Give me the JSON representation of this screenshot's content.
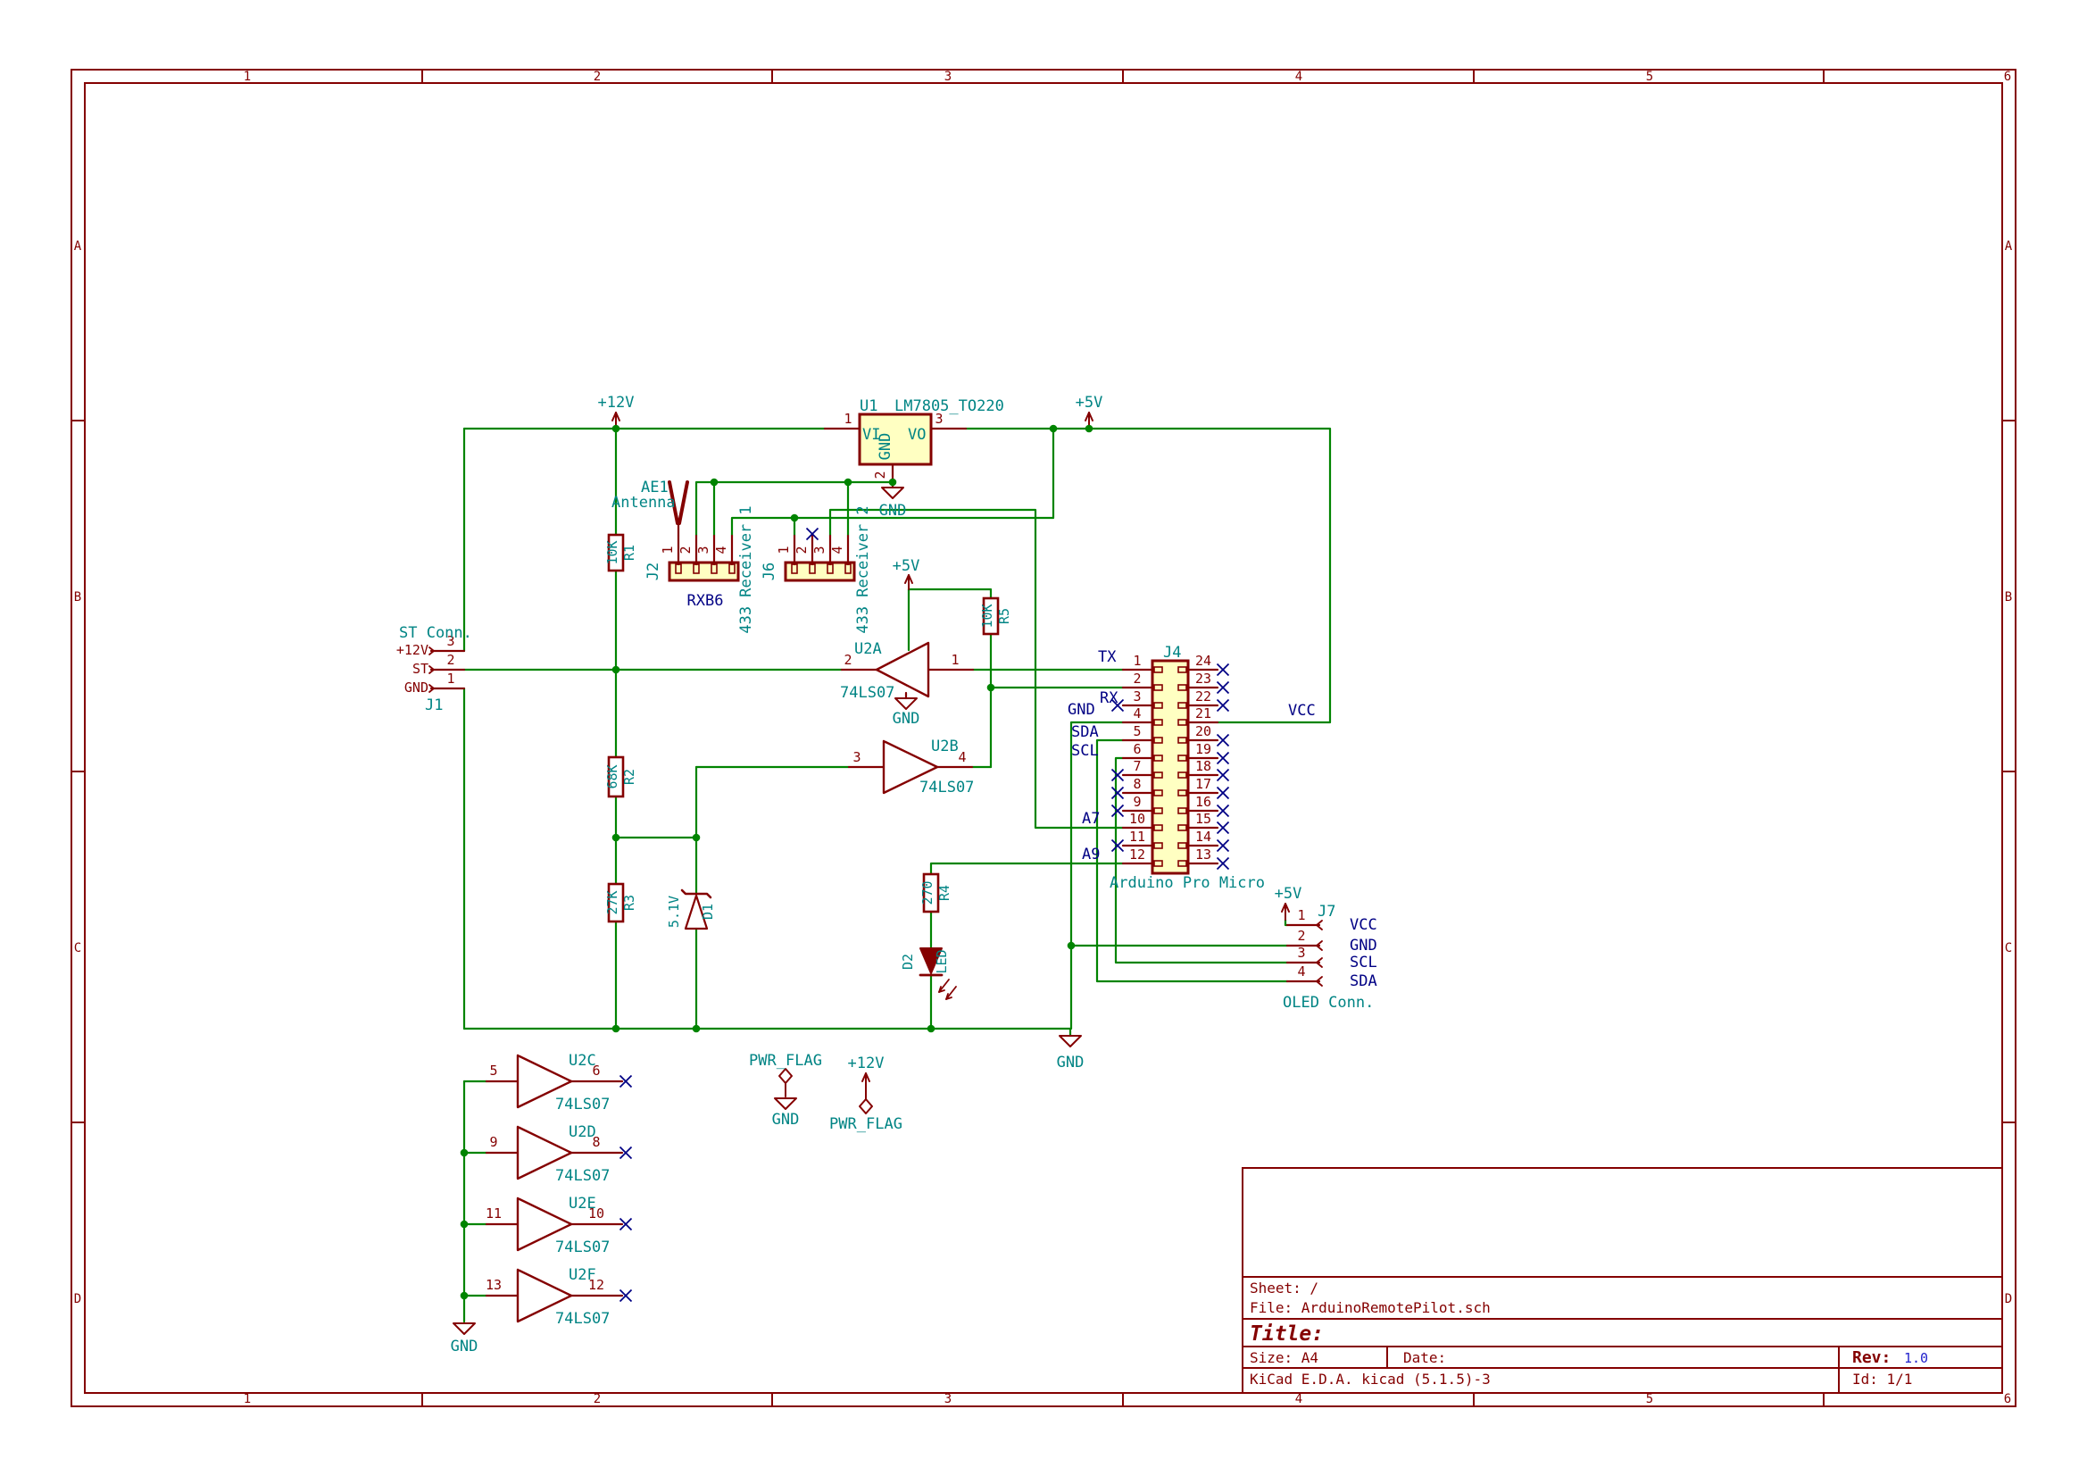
{
  "colors": {
    "wire": "#008400",
    "symbol": "#840000",
    "field": "#008484",
    "label": "#000084",
    "body_fill": "#FFFFC2",
    "paper": "#FFFFFF"
  },
  "schematic": {
    "power_labels": {
      "p12v": "+12V",
      "p5v": "+5V",
      "gnd": "GND",
      "pwr_flag": "PWR_FLAG"
    },
    "net_labels": {
      "tx": "TX",
      "rx": "RX",
      "gnd": "GND",
      "sda": "SDA",
      "scl": "SCL",
      "a7": "A7",
      "a9": "A9",
      "vcc": "VCC"
    },
    "components": {
      "u1": {
        "ref": "U1",
        "value": "LM7805_TO220",
        "pin_nums": [
          "1",
          "2",
          "3"
        ],
        "pin_names": {
          "vi": "VI",
          "vo": "VO",
          "gnd": "GND"
        }
      },
      "j1": {
        "ref": "J1",
        "value": "ST Conn.",
        "pins": [
          {
            "num": "3",
            "name": "+12V"
          },
          {
            "num": "2",
            "name": "ST"
          },
          {
            "num": "1",
            "name": "GND"
          }
        ]
      },
      "ae1": {
        "ref": "AE1",
        "value": "Antenna"
      },
      "j2": {
        "ref": "J2",
        "value": "RXB6",
        "label": "433 Receiver 1",
        "pins": [
          "1",
          "2",
          "3",
          "4"
        ]
      },
      "j6": {
        "ref": "J6",
        "label": "433 Receiver 2",
        "pins": [
          "1",
          "2",
          "3",
          "4"
        ]
      },
      "r1": {
        "ref": "R1",
        "value": "10K"
      },
      "r2": {
        "ref": "R2",
        "value": "68K"
      },
      "r3": {
        "ref": "R3",
        "value": "27K"
      },
      "r4": {
        "ref": "R4",
        "value": "270"
      },
      "r5": {
        "ref": "R5",
        "value": "10K"
      },
      "d1": {
        "ref": "D1",
        "value": "5.1V"
      },
      "d2": {
        "ref": "D2",
        "value": "LED"
      },
      "u2": {
        "value": "74LS07",
        "units": [
          {
            "ref": "U2A",
            "in": "2",
            "out": "1"
          },
          {
            "ref": "U2B",
            "in": "3",
            "out": "4"
          },
          {
            "ref": "U2C",
            "in": "5",
            "out": "6"
          },
          {
            "ref": "U2D",
            "in": "9",
            "out": "8"
          },
          {
            "ref": "U2E",
            "in": "11",
            "out": "10"
          },
          {
            "ref": "U2F",
            "in": "13",
            "out": "12"
          }
        ]
      },
      "j4": {
        "ref": "J4",
        "label": "Arduino Pro Micro",
        "left_pins": [
          "1",
          "2",
          "3",
          "4",
          "5",
          "6",
          "7",
          "8",
          "9",
          "10",
          "11",
          "12"
        ],
        "right_pins": [
          "24",
          "23",
          "22",
          "21",
          "20",
          "19",
          "18",
          "17",
          "16",
          "15",
          "14",
          "13"
        ]
      },
      "j7": {
        "ref": "J7",
        "label": "OLED Conn.",
        "pins": [
          {
            "num": "1",
            "name": "VCC"
          },
          {
            "num": "2",
            "name": "GND"
          },
          {
            "num": "3",
            "name": "SCL"
          },
          {
            "num": "4",
            "name": "SDA"
          }
        ]
      }
    },
    "border": {
      "columns": [
        "1",
        "2",
        "3",
        "4",
        "5",
        "6"
      ],
      "rows": [
        "A",
        "B",
        "C",
        "D"
      ]
    },
    "title_block": {
      "sheet": "Sheet: /",
      "file": "File: ArduinoRemotePilot.sch",
      "title_label": "Title:",
      "size": "Size: A4",
      "date": "Date:",
      "rev_label": "Rev:",
      "rev_value": "1.0",
      "generator": "KiCad E.D.A.  kicad (5.1.5)-3",
      "id": "Id: 1/1"
    }
  }
}
